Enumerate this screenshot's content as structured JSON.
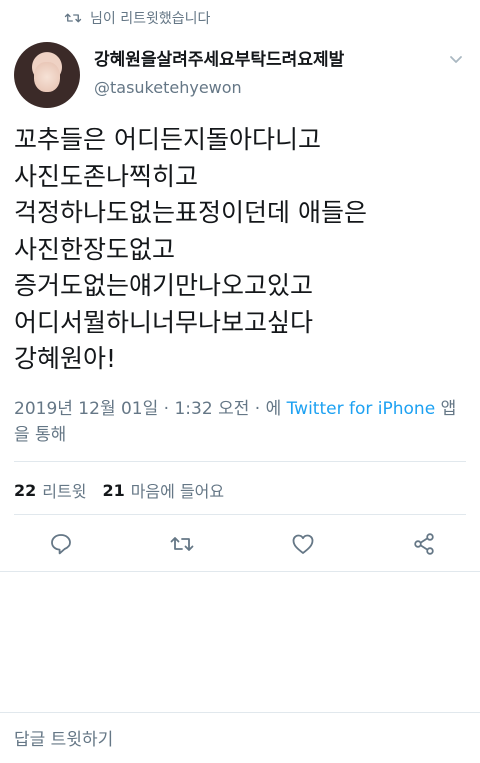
{
  "retweet_context": {
    "text": "님이 리트윗했습니다",
    "icon": "retweet-icon"
  },
  "author": {
    "display_name": "강혜원을살려주세요부탁드려요제발",
    "handle": "@tasuketehyewon"
  },
  "tweet": {
    "lines": [
      "꼬추들은 어디든지돌아다니고",
      "사진도존나찍히고",
      "걱정하나도없는표정이던데 애들은",
      "사진한장도없고",
      "증거도없는얘기만나오고있고",
      "어디서뭘하니너무나보고싶다",
      "강혜원아!"
    ]
  },
  "meta": {
    "date": "2019년 12월 01일",
    "separator": "·",
    "time": "1:32 오전",
    "via_prefix": "에",
    "client": "Twitter for iPhone",
    "via_suffix": "앱을 통해"
  },
  "stats": {
    "retweets_count": "22",
    "retweets_label": "리트윗",
    "likes_count": "21",
    "likes_label": "마음에 들어요"
  },
  "actions": {
    "reply_icon": "reply-icon",
    "retweet_icon": "retweet-icon",
    "like_icon": "heart-icon",
    "share_icon": "share-icon"
  },
  "reply_bar": {
    "placeholder": "답글 트윗하기"
  },
  "colors": {
    "text": "#14171a",
    "secondary": "#657786",
    "link": "#1da1f2",
    "divider": "#e1e8ed"
  }
}
